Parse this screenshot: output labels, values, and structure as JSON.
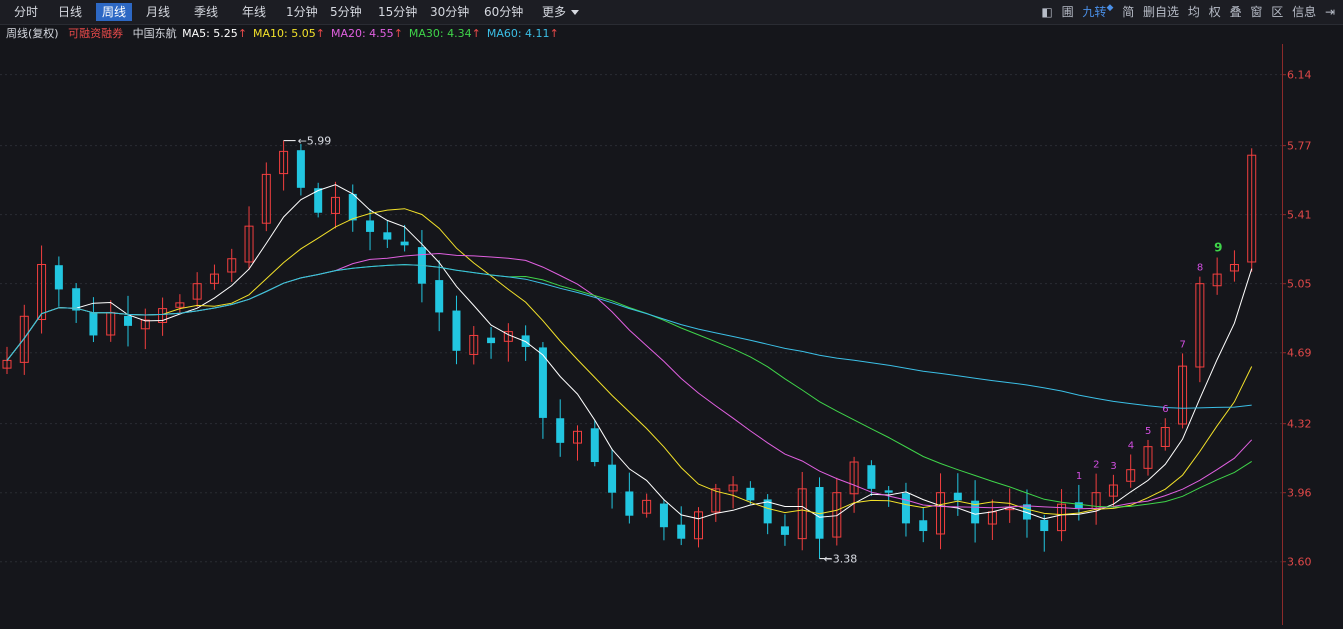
{
  "toolbar": {
    "tabs": [
      "分时",
      "日线",
      "周线",
      "月线",
      "季线",
      "年线",
      "1分钟",
      "5分钟",
      "15分钟",
      "30分钟",
      "60分钟",
      "更多"
    ],
    "active_tab": "周线",
    "right_tools": {
      "back": "◧",
      "grid": "圃",
      "nine_turn": "九转",
      "simple": "简",
      "remove_self_select": "删自选",
      "avg": "均",
      "right": "权",
      "overlay": "叠",
      "window": "窗",
      "zone": "区",
      "info": "信息"
    }
  },
  "info": {
    "period_label": "周线(复权)",
    "margin_label": "可融资融券",
    "stock_name": "中国东航",
    "ma": [
      {
        "label": "MA5:",
        "value": "5.25",
        "arrow": "↑",
        "color": "#ffffff"
      },
      {
        "label": "MA10:",
        "value": "5.05",
        "arrow": "↑",
        "color": "#f2e12a"
      },
      {
        "label": "MA20:",
        "value": "4.55",
        "arrow": "↑",
        "color": "#e060e0"
      },
      {
        "label": "MA30:",
        "value": "4.34",
        "arrow": "↑",
        "color": "#3fd44a"
      },
      {
        "label": "MA60:",
        "value": "4.11",
        "arrow": "↑",
        "color": "#3bbfe6"
      }
    ]
  },
  "chart_data": {
    "type": "candlestick",
    "ylim": [
      3.27,
      6.3
    ],
    "yticks": [
      "6.14",
      "5.77",
      "5.41",
      "5.05",
      "4.69",
      "4.32",
      "3.96",
      "3.60"
    ],
    "high_annotation": {
      "label": "5.99"
    },
    "low_annotation": {
      "label": "3.38"
    },
    "td_up_colors": {
      "magenta": "#d14ee0",
      "green": "#3fd44a"
    },
    "td_labels": [
      "1",
      "2",
      "3",
      "4",
      "5",
      "6",
      "7",
      "8",
      "9"
    ],
    "close": [
      4.65,
      4.88,
      5.15,
      5.02,
      4.91,
      4.78,
      4.9,
      4.83,
      4.86,
      4.92,
      4.95,
      5.05,
      5.1,
      5.18,
      5.35,
      5.62,
      5.74,
      5.55,
      5.42,
      5.5,
      5.38,
      5.32,
      5.28,
      5.25,
      5.05,
      4.9,
      4.7,
      4.78,
      4.74,
      4.8,
      4.72,
      4.35,
      4.22,
      4.28,
      4.12,
      3.96,
      3.84,
      3.92,
      3.78,
      3.72,
      3.86,
      3.98,
      4.0,
      3.92,
      3.8,
      3.74,
      3.98,
      3.72,
      3.96,
      4.12,
      3.98,
      3.96,
      3.8,
      3.76,
      3.96,
      3.92,
      3.8,
      3.86,
      3.88,
      3.82,
      3.76,
      3.9,
      3.88,
      3.96,
      4.0,
      4.08,
      4.2,
      4.3,
      4.62,
      5.05,
      5.1,
      5.15,
      5.72
    ]
  }
}
